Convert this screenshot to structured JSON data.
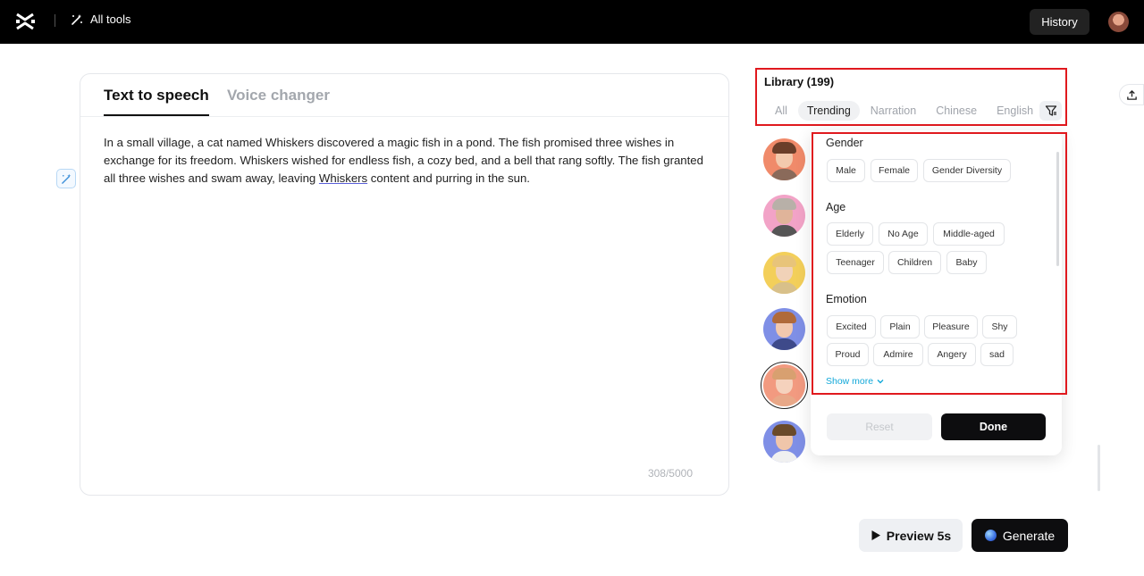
{
  "header": {
    "all_tools_label": "All tools",
    "history_label": "History"
  },
  "editor": {
    "tabs": [
      {
        "label": "Text to speech",
        "active": true
      },
      {
        "label": "Voice changer",
        "active": false
      }
    ],
    "text_before": "In a small village, a cat named Whiskers discovered a magic fish in a pond. The fish promised three wishes in exchange for its freedom. Whiskers wished for endless fish, a cozy bed, and a bell that rang softly. The fish granted all three wishes and swam away, leaving ",
    "text_underlined": "Whiskers",
    "text_after": " content and purring in the sun.",
    "char_count": "308/5000"
  },
  "library": {
    "title": "Library (199)",
    "categories": [
      {
        "label": "All",
        "active": false
      },
      {
        "label": "Trending",
        "active": true
      },
      {
        "label": "Narration",
        "active": false
      },
      {
        "label": "Chinese",
        "active": false
      },
      {
        "label": "English",
        "active": false
      }
    ]
  },
  "filters": {
    "gender": {
      "title": "Gender",
      "options": [
        "Male",
        "Female",
        "Gender Diversity"
      ]
    },
    "age": {
      "title": "Age",
      "options": [
        "Elderly",
        "No Age",
        "Middle-aged",
        "Teenager",
        "Children",
        "Baby"
      ]
    },
    "emotion": {
      "title": "Emotion",
      "options": [
        "Excited",
        "Plain",
        "Pleasure",
        "Shy",
        "Proud",
        "Admire",
        "Angery",
        "sad"
      ]
    },
    "show_more_label": "Show more",
    "reset_label": "Reset",
    "done_label": "Done"
  },
  "actions": {
    "preview_label": "Preview 5s",
    "generate_label": "Generate"
  },
  "colors": {
    "highlight_border": "#e0191e",
    "link": "#12a8d9",
    "primary_dark": "#0d0d0f"
  }
}
